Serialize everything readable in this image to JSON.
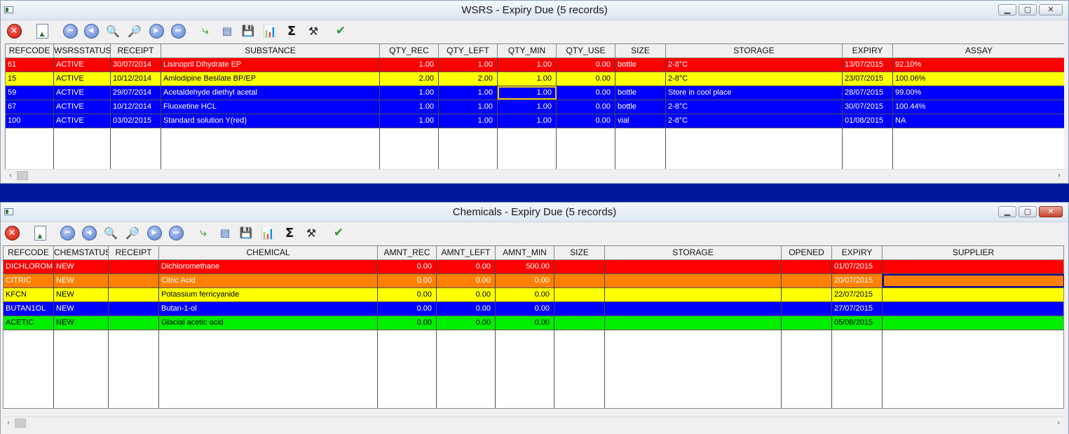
{
  "wsrs": {
    "title": "WSRS - Expiry Due (5 records)",
    "columns": [
      "REFCODE",
      "WSRSSTATUS",
      "RECEIPT",
      "SUBSTANCE",
      "QTY_REC",
      "QTY_LEFT",
      "QTY_MIN",
      "QTY_USE",
      "SIZE",
      "STORAGE",
      "EXPIRY",
      "ASSAY"
    ],
    "rows": [
      {
        "color": "#ff0000",
        "cells": [
          "61",
          "ACTIVE",
          "30/07/2014",
          "Lisinopril Dihydrate EP",
          "1.00",
          "1.00",
          "1.00",
          "0.00",
          "bottle",
          "2-8°C",
          "13/07/2015",
          "92.10%"
        ]
      },
      {
        "color": "#ffff00",
        "cells": [
          "15",
          "ACTIVE",
          "10/12/2014",
          "Amlodipine Besilate BP/EP",
          "2.00",
          "2.00",
          "1.00",
          "0.00",
          "",
          "2-8°C",
          "23/07/2015",
          "100.06%"
        ]
      },
      {
        "color": "#0000ff",
        "cells": [
          "59",
          "ACTIVE",
          "29/07/2014",
          "Acetaldehyde diethyl acetal",
          "1.00",
          "1.00",
          "1.00",
          "0.00",
          "bottle",
          "Store in cool place",
          "28/07/2015",
          "99.00%"
        ]
      },
      {
        "color": "#0000ff",
        "cells": [
          "67",
          "ACTIVE",
          "10/12/2014",
          "Fluoxetine HCL",
          "1.00",
          "1.00",
          "1.00",
          "0.00",
          "bottle",
          "2-8°C",
          "30/07/2015",
          "100.44%"
        ]
      },
      {
        "color": "#0000ff",
        "cells": [
          "100",
          "ACTIVE",
          "03/02/2015",
          "Standard solution Y(red)",
          "1.00",
          "1.00",
          "1.00",
          "0.00",
          "vial",
          "2-8°C",
          "01/08/2015",
          "NA"
        ]
      }
    ]
  },
  "chem": {
    "title": "Chemicals - Expiry Due (5 records)",
    "columns": [
      "REFCODE",
      "CHEMSTATUS",
      "RECEIPT",
      "CHEMICAL",
      "AMNT_REC",
      "AMNT_LEFT",
      "AMNT_MIN",
      "SIZE",
      "STORAGE",
      "OPENED",
      "EXPIRY",
      "SUPPLIER"
    ],
    "rows": [
      {
        "color": "#ff0000",
        "cells": [
          "DICHLOROM",
          "NEW",
          "",
          "Dichloromethane",
          "0.00",
          "0.00",
          "500.00",
          "",
          "",
          "",
          "01/07/2015",
          ""
        ]
      },
      {
        "color": "#ff8000",
        "cells": [
          "CITRIC",
          "NEW",
          "",
          "Citric Acid",
          "0.00",
          "0.00",
          "0.00",
          "",
          "",
          "",
          "20/07/2015",
          ""
        ]
      },
      {
        "color": "#ffff00",
        "cells": [
          "KFCN",
          "NEW",
          "",
          "Potassium ferricyanide",
          "0.00",
          "0.00",
          "0.00",
          "",
          "",
          "",
          "22/07/2015",
          ""
        ]
      },
      {
        "color": "#0000ff",
        "cells": [
          "BUTAN1OL",
          "NEW",
          "",
          "Butan-1-ol",
          "0.00",
          "0.00",
          "0.00",
          "",
          "",
          "",
          "27/07/2015",
          ""
        ]
      },
      {
        "color": "#00ee00",
        "cells": [
          "ACETIC",
          "NEW",
          "",
          "Glacial acetic acid",
          "0.00",
          "0.00",
          "0.00",
          "",
          "",
          "",
          "05/08/2015",
          ""
        ]
      }
    ]
  },
  "toolbar_icons": [
    "close-icon",
    "document-icon",
    "first-icon",
    "previous-icon",
    "search-icon",
    "zoom-icon",
    "next-icon",
    "last-icon",
    "refresh-icon",
    "print-icon",
    "save-icon",
    "chart-icon",
    "sigma-icon",
    "tools-icon",
    "ok-icon"
  ]
}
